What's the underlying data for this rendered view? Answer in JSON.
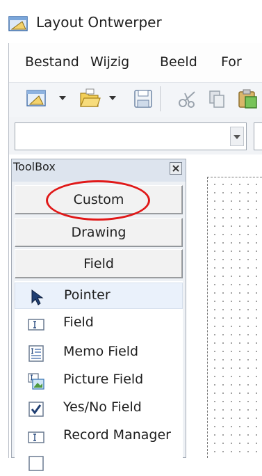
{
  "window": {
    "title": "Layout Ontwerper",
    "app_icon": "layout-designer-icon"
  },
  "menu": {
    "items": [
      "Bestand",
      "Wijzig",
      "Beeld",
      "For"
    ]
  },
  "toolbar": {
    "icons": [
      "new-document-icon",
      "dropdown-arrow-icon",
      "open-folder-icon",
      "dropdown-arrow-icon",
      "save-icon",
      "cut-icon",
      "copy-icon",
      "paste-icon"
    ]
  },
  "format_bar": {
    "font_combo_value": ""
  },
  "toolbox": {
    "title": "ToolBox",
    "categories": [
      "Custom",
      "Drawing",
      "Field"
    ],
    "highlighted_category": "Custom",
    "annotation_color": "#e01818",
    "tools": [
      {
        "label": "Pointer",
        "icon": "pointer-arrow-icon",
        "selected": true
      },
      {
        "label": "Field",
        "icon": "text-field-icon",
        "selected": false
      },
      {
        "label": "Memo Field",
        "icon": "memo-field-icon",
        "selected": false
      },
      {
        "label": "Picture Field",
        "icon": "picture-field-icon",
        "selected": false
      },
      {
        "label": "Yes/No Field",
        "icon": "checkbox-icon",
        "selected": false
      },
      {
        "label": "Record Manager",
        "icon": "record-manager-icon",
        "selected": false
      }
    ]
  }
}
